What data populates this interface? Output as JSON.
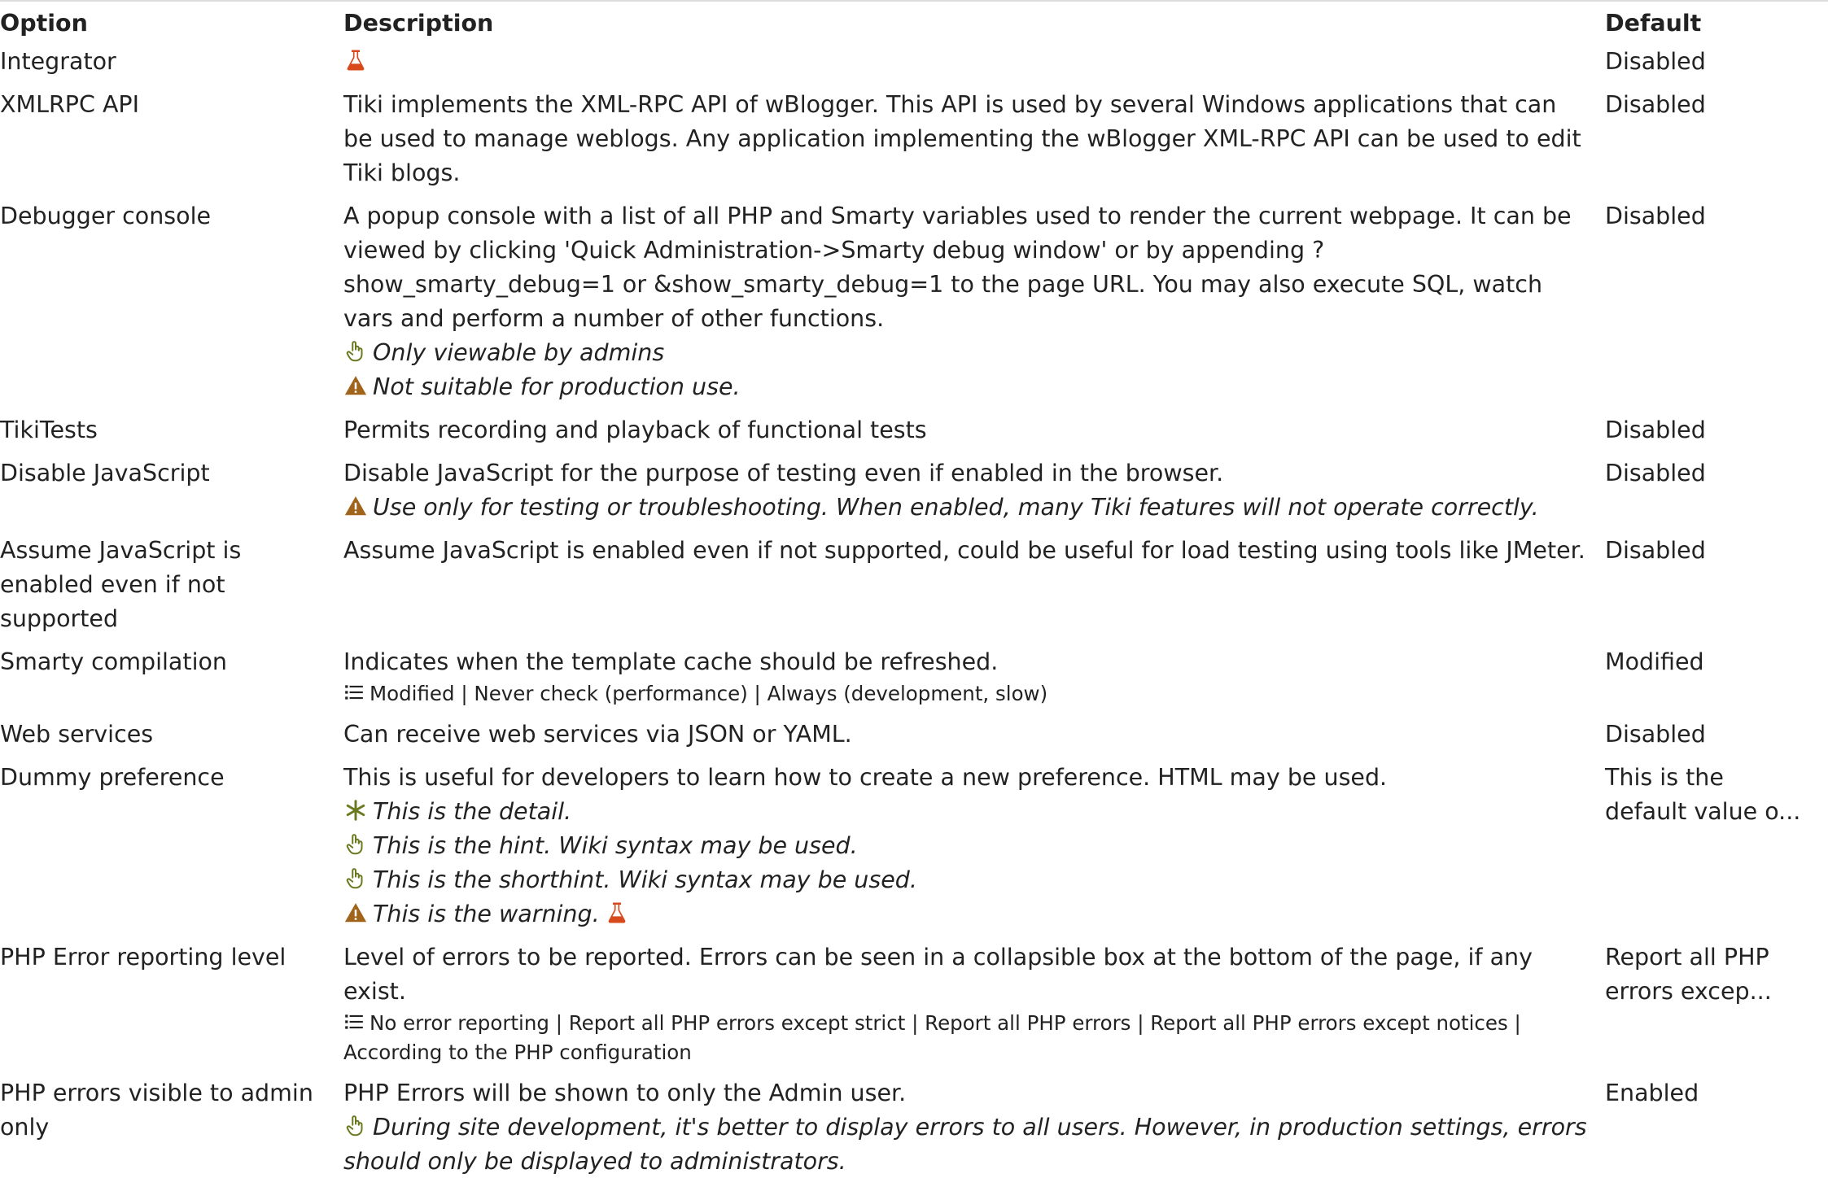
{
  "headers": {
    "option": "Option",
    "description": "Description",
    "default": "Default"
  },
  "colors": {
    "flask": "#d84a1b",
    "warning": "#a0641a",
    "hint": "#6b7a1f",
    "text": "#222222"
  },
  "rows": [
    {
      "option": "Integrator",
      "description": "",
      "default": "Disabled"
    },
    {
      "option": "XMLRPC API",
      "description": "Tiki implements the XML-RPC API of wBlogger. This API is used by several Windows applications that can be used to manage weblogs. Any application implementing the wBlogger XML-RPC API can be used to edit Tiki blogs.",
      "default": "Disabled"
    },
    {
      "option": "Debugger console",
      "description": "A popup console with a list of all PHP and Smarty variables used to render the current webpage. It can be viewed by clicking 'Quick Administration->Smarty debug window' or by appending ?show_smarty_debug=1 or &show_smarty_debug=1 to the page URL. You may also execute SQL, watch vars and perform a number of other functions.",
      "hint": "Only viewable by admins",
      "warning": "Not suitable for production use.",
      "default": "Disabled"
    },
    {
      "option": "TikiTests",
      "description": "Permits recording and playback of functional tests",
      "default": "Disabled"
    },
    {
      "option": "Disable JavaScript",
      "description": "Disable JavaScript for the purpose of testing even if enabled in the browser.",
      "warning": "Use only for testing or troubleshooting. When enabled, many Tiki features will not operate correctly.",
      "default": "Disabled"
    },
    {
      "option": "Assume JavaScript is enabled even if not supported",
      "description": "Assume JavaScript is enabled even if not supported, could be useful for load testing using tools like JMeter.",
      "default": "Disabled"
    },
    {
      "option": "Smarty compilation",
      "description": "Indicates when the template cache should be refreshed.",
      "options": "Modified | Never check (performance) | Always (development, slow)",
      "default": "Modified"
    },
    {
      "option": "Web services",
      "description": "Can receive web services via JSON or YAML.",
      "default": "Disabled"
    },
    {
      "option": "Dummy preference",
      "description": "This is useful for developers to learn how to create a new preference. HTML may be used.",
      "detail": "This is the detail.",
      "hint": "This is the hint. Wiki syntax may be used.",
      "shorthint": "This is the shorthint. Wiki syntax may be used.",
      "warning": "This is the warning.",
      "default": "This is the default value o..."
    },
    {
      "option": "PHP Error reporting level",
      "description": "Level of errors to be reported. Errors can be seen in a collapsible box at the bottom of the page, if any exist.",
      "options": "No error reporting | Report all PHP errors except strict | Report all PHP errors | Report all PHP errors except notices | According to the PHP configuration",
      "default": "Report all PHP errors excep..."
    },
    {
      "option": "PHP errors visible to admin only",
      "description": "PHP Errors will be shown to only the Admin user.",
      "hint": "During site development, it's better to display errors to all users. However, in production settings, errors should only be displayed to administrators.",
      "default": "Enabled"
    }
  ]
}
